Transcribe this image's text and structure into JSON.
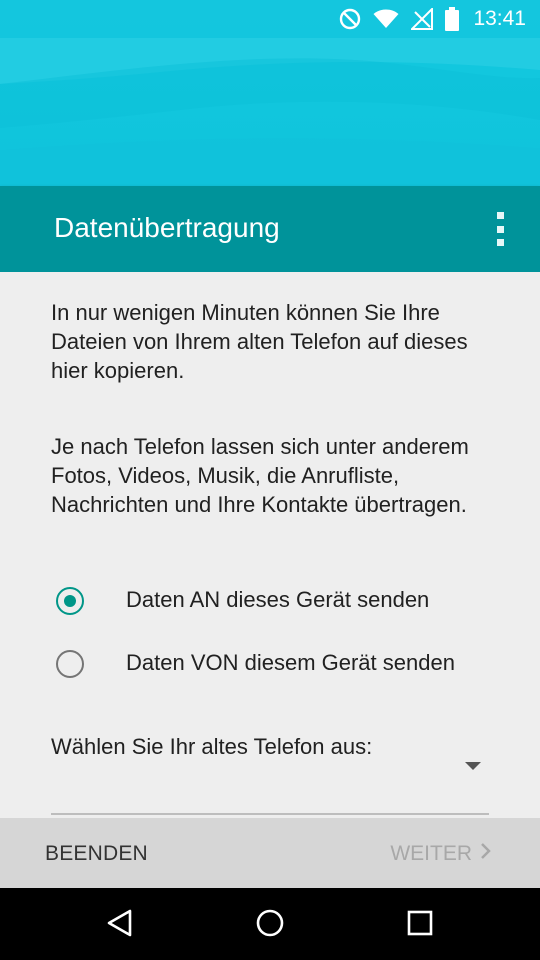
{
  "status_bar": {
    "time": "13:41",
    "icons": [
      "do-not-disturb-icon",
      "wifi-icon",
      "no-signal-icon",
      "battery-icon"
    ]
  },
  "app_bar": {
    "title": "Datenübertragung",
    "menu_icon": "overflow-menu-icon"
  },
  "content": {
    "paragraph_1": "In nur wenigen Minuten können Sie Ihre Dateien von Ihrem alten Telefon auf dieses hier kopieren.",
    "paragraph_2": "Je nach Telefon lassen sich unter anderem Fotos, Videos, Musik, die Anrufliste, Nachrichten und Ihre Kontakte übertragen.",
    "options": [
      {
        "label": "Daten AN dieses Gerät senden",
        "selected": true
      },
      {
        "label": "Daten VON diesem Gerät senden",
        "selected": false
      }
    ],
    "select_label": "Wählen Sie Ihr altes Telefon aus:"
  },
  "buttons": {
    "end_label": "BEENDEN",
    "next_label": "WEITER"
  },
  "colors": {
    "hero": "#12c7de",
    "app_bar": "#00939a",
    "accent": "#009688"
  }
}
